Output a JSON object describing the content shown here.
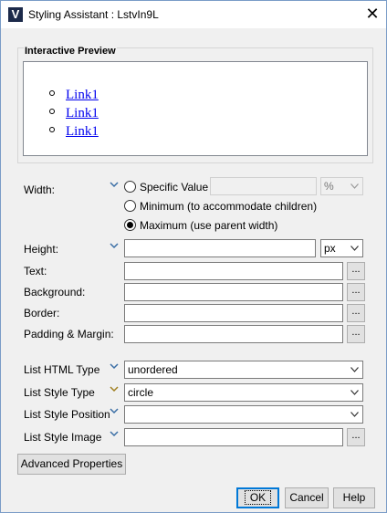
{
  "window": {
    "title": "Styling Assistant : LstvIn9L",
    "app_icon": "v-logo-icon",
    "close_icon": "close-icon"
  },
  "preview": {
    "title": "Interactive Preview",
    "links": [
      "Link1",
      "Link1",
      "Link1"
    ]
  },
  "width": {
    "label": "Width:",
    "options": {
      "specific": "Specific Value",
      "minimum": "Minimum (to accommodate children)",
      "maximum": "Maximum (use parent width)"
    },
    "selected": "maximum",
    "value": "",
    "unit": "%"
  },
  "height": {
    "label": "Height:",
    "value": "",
    "unit": "px"
  },
  "text": {
    "label": "Text:",
    "value": "",
    "button": "..."
  },
  "background": {
    "label": "Background:",
    "value": "",
    "button": "..."
  },
  "border": {
    "label": "Border:",
    "value": "",
    "button": "..."
  },
  "padding": {
    "label": "Padding & Margin:",
    "value": "",
    "button": "..."
  },
  "list_html_type": {
    "label": "List HTML Type",
    "value": "unordered"
  },
  "list_style_type": {
    "label": "List Style Type",
    "value": "circle"
  },
  "list_style_position": {
    "label": "List Style Position",
    "value": ""
  },
  "list_style_image": {
    "label": "List Style Image",
    "value": "",
    "button": "..."
  },
  "buttons": {
    "advanced": "Advanced Properties",
    "ok": "OK",
    "cancel": "Cancel",
    "help": "Help"
  },
  "colors": {
    "chevron_blue": "#3a6ea5",
    "chevron_gold": "#a08020",
    "link": "#0000ee",
    "border_accent": "#0078d7"
  }
}
